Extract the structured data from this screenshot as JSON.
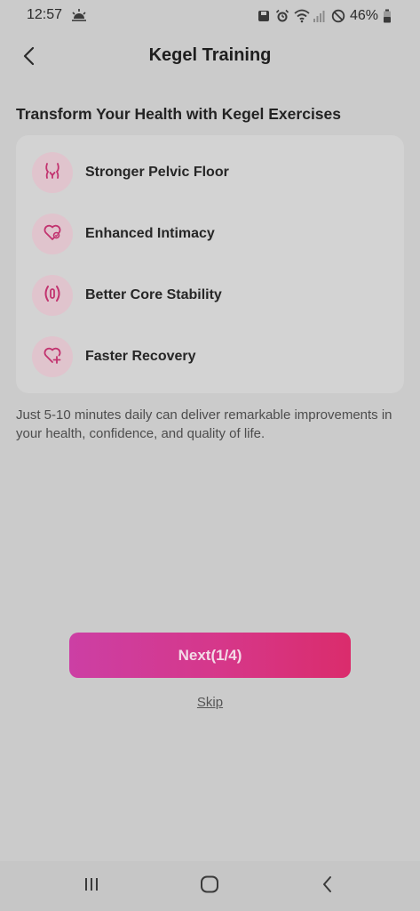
{
  "status_bar": {
    "time": "12:57",
    "battery": "46%"
  },
  "header": {
    "title": "Kegel Training"
  },
  "section": {
    "heading": "Transform Your Health with Kegel Exercises"
  },
  "benefits": [
    {
      "label": "Stronger Pelvic Floor",
      "icon": "pelvis-icon"
    },
    {
      "label": "Enhanced Intimacy",
      "icon": "heart-icon"
    },
    {
      "label": "Better Core Stability",
      "icon": "core-icon"
    },
    {
      "label": "Faster Recovery",
      "icon": "heart-plus-icon"
    }
  ],
  "description": "Just 5-10 minutes daily can deliver remarkable improvements in your health, confidence, and quality of life.",
  "actions": {
    "next_label": "Next(1/4)",
    "skip_label": "Skip"
  },
  "colors": {
    "accent": "#d63789",
    "icon_pink": "#c2336f",
    "icon_bg": "#e0c4cd"
  }
}
